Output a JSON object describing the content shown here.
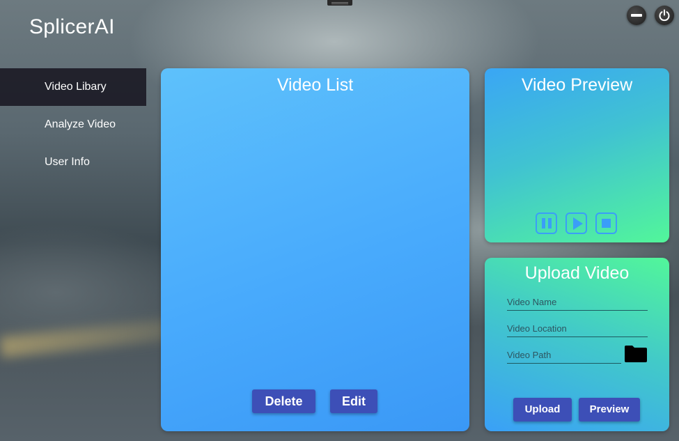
{
  "app": {
    "title": "SplicerAI"
  },
  "sidebar": {
    "items": [
      {
        "label": "Video Libary",
        "active": true
      },
      {
        "label": "Analyze Video",
        "active": false
      },
      {
        "label": "User Info",
        "active": false
      }
    ]
  },
  "video_list": {
    "title": "Video List",
    "delete_label": "Delete",
    "edit_label": "Edit"
  },
  "video_preview": {
    "title": "Video Preview",
    "controls": [
      "pause-icon",
      "play-icon",
      "stop-icon"
    ]
  },
  "upload_video": {
    "title": "Upload Video",
    "name_placeholder": "Video Name",
    "location_placeholder": "Video Location",
    "path_placeholder": "Video Path",
    "upload_label": "Upload",
    "preview_label": "Preview"
  },
  "window_controls": [
    "minimize-icon",
    "power-icon"
  ],
  "colors": {
    "button": "#3d4fb7",
    "control_accent": "#3a9ef8",
    "sidebar_active": "#1c1b26"
  }
}
